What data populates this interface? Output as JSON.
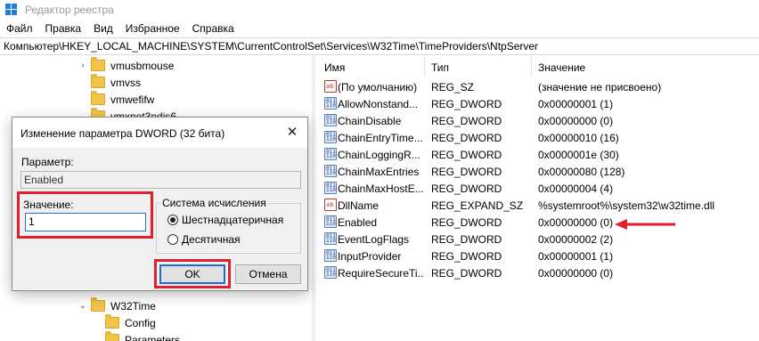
{
  "window": {
    "title": "Редактор реестра"
  },
  "menu": [
    "Файл",
    "Правка",
    "Вид",
    "Избранное",
    "Справка"
  ],
  "address": "Компьютер\\HKEY_LOCAL_MACHINE\\SYSTEM\\CurrentControlSet\\Services\\W32Time\\TimeProviders\\NtpServer",
  "tree": {
    "top_items": [
      "vmusbmouse",
      "vmvss",
      "vmwefifw",
      "vmxnet3ndis6"
    ],
    "w32time": "W32Time",
    "children": [
      "Config",
      "Parameters"
    ]
  },
  "list": {
    "headers": {
      "name": "Имя",
      "type": "Тип",
      "value": "Значение"
    },
    "rows": [
      {
        "name": "(По умолчанию)",
        "type": "REG_SZ",
        "value": "(значение не присвоено)",
        "icon": "string-value-icon"
      },
      {
        "name": "AllowNonstand...",
        "type": "REG_DWORD",
        "value": "0x00000001 (1)",
        "icon": "binary-value-icon"
      },
      {
        "name": "ChainDisable",
        "type": "REG_DWORD",
        "value": "0x00000000 (0)",
        "icon": "binary-value-icon"
      },
      {
        "name": "ChainEntryTime...",
        "type": "REG_DWORD",
        "value": "0x00000010 (16)",
        "icon": "binary-value-icon"
      },
      {
        "name": "ChainLoggingR...",
        "type": "REG_DWORD",
        "value": "0x0000001e (30)",
        "icon": "binary-value-icon"
      },
      {
        "name": "ChainMaxEntries",
        "type": "REG_DWORD",
        "value": "0x00000080 (128)",
        "icon": "binary-value-icon"
      },
      {
        "name": "ChainMaxHostE...",
        "type": "REG_DWORD",
        "value": "0x00000004 (4)",
        "icon": "binary-value-icon"
      },
      {
        "name": "DllName",
        "type": "REG_EXPAND_SZ",
        "value": "%systemroot%\\system32\\w32time.dll",
        "icon": "string-value-icon"
      },
      {
        "name": "Enabled",
        "type": "REG_DWORD",
        "value": "0x00000000 (0)",
        "icon": "binary-value-icon"
      },
      {
        "name": "EventLogFlags",
        "type": "REG_DWORD",
        "value": "0x00000002 (2)",
        "icon": "binary-value-icon"
      },
      {
        "name": "InputProvider",
        "type": "REG_DWORD",
        "value": "0x00000001 (1)",
        "icon": "binary-value-icon"
      },
      {
        "name": "RequireSecureTi...",
        "type": "REG_DWORD",
        "value": "0x00000000 (0)",
        "icon": "binary-value-icon"
      }
    ]
  },
  "dialog": {
    "title": "Изменение параметра DWORD (32 бита)",
    "param_label": "Параметр:",
    "param_value": "Enabled",
    "value_label": "Значение:",
    "value": "1",
    "base_label": "Система исчисления",
    "radio_hex": "Шестнадцатеричная",
    "radio_dec": "Десятичная",
    "ok": "OK",
    "cancel": "Отмена"
  },
  "colors": {
    "highlight": "#e0202d",
    "accent": "#1a6ad6"
  }
}
